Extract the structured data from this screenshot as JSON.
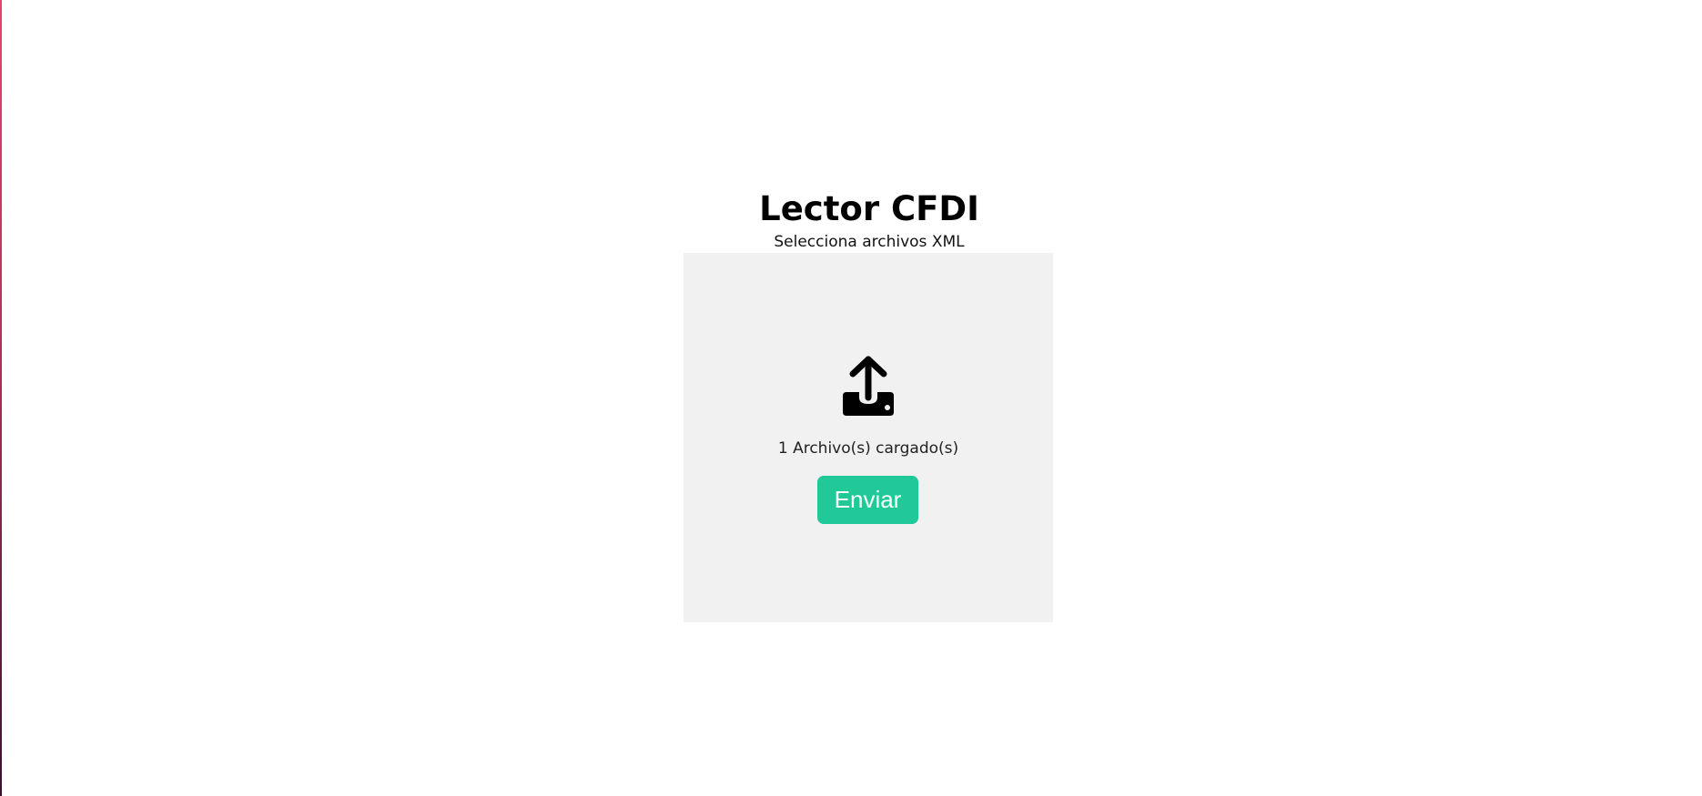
{
  "header": {
    "title": "Lector CFDI",
    "subtitle": "Selecciona archivos XML"
  },
  "dropzone": {
    "icon": "upload-icon",
    "status_text": "1 Archivo(s) cargado(s)",
    "send_label": "Enviar"
  },
  "colors": {
    "accent": "#20c997",
    "dropzone_bg": "#f1f1f1"
  }
}
